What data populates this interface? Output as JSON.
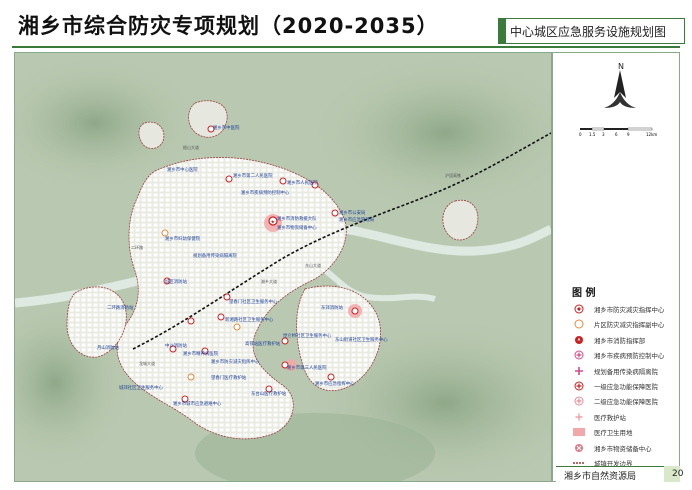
{
  "header": {
    "title": "湘乡市综合防灾专项规划（2020-2035）",
    "subtitle": "中心城区应急服务设施规划图"
  },
  "north": {
    "label": "N"
  },
  "scalebar": {
    "ticks": [
      "0",
      "1.5",
      "3",
      "6",
      "9",
      "12km"
    ]
  },
  "legend": {
    "title": "图 例",
    "items": [
      {
        "label": "湘乡市防灾减灾指挥中心",
        "symbol": "red-star-circle"
      },
      {
        "label": "片区防灾减灾指挥副中心",
        "symbol": "orange-ring"
      },
      {
        "label": "湘乡市消防指挥部",
        "symbol": "red-flame-circle"
      },
      {
        "label": "湘乡市疾病预防控制中心",
        "symbol": "pink-cross-circle"
      },
      {
        "label": "规划备用传染病隔离院",
        "symbol": "pink-plus"
      },
      {
        "label": "一级应急功能保障医院",
        "symbol": "red-plus-circle"
      },
      {
        "label": "二级应急功能保障医院",
        "symbol": "pink-plus-circle"
      },
      {
        "label": "医疗救护站",
        "symbol": "light-plus"
      },
      {
        "label": "医疗卫生用地",
        "symbol": "pink-fill"
      },
      {
        "label": "湘乡市物资储备中心",
        "symbol": "pink-cross-fill"
      },
      {
        "label": "城镇开发边界",
        "symbol": "dashed-red-line"
      }
    ]
  },
  "footer": {
    "agency": "湘乡市自然资源局",
    "page": "20"
  },
  "map": {
    "colors": {
      "base": "#b9c9b1",
      "water": "#dbe8df",
      "urban": "#e6e8e0",
      "boundary": "#9a3a3a",
      "rail": "#111111",
      "label": "#1e3f9a"
    },
    "labels": [
      "湘乡市中医院",
      "湘乡市中心医院",
      "湘乡市第二人民医院",
      "湘乡市人民医院",
      "湘乡市疾病预防控制中心",
      "湘乡市妇幼保健院",
      "湘乡市消防救援大队",
      "湘乡市物资储备中心",
      "湘乡市公安局",
      "湘乡市应急管理局",
      "东山街道社区卫生服务中心",
      "新湘路社区卫生服务中心",
      "望春门社区卫生服务中心",
      "昆仑桥社区卫生服务中心",
      "规划备用传染病隔离院",
      "城郊社区卫生服务中心",
      "湘乡市第三人民医院",
      "城区消防站",
      "东郊消防站",
      "二环路消防站",
      "月山消防站",
      "湘乡市精神病医院",
      "湘乡市防灾减灾指挥中心",
      "中沙消防站",
      "高铁站医疗救护站",
      "望春门医疗救护站",
      "东台山医疗救护站",
      "湘乡市应急指挥中心",
      "湘乡市城市应急避难中心"
    ],
    "roads": [
      "韶山大道",
      "二环路",
      "东山大道",
      "龙城大道",
      "湘乡大道",
      "沪昆高铁"
    ]
  }
}
